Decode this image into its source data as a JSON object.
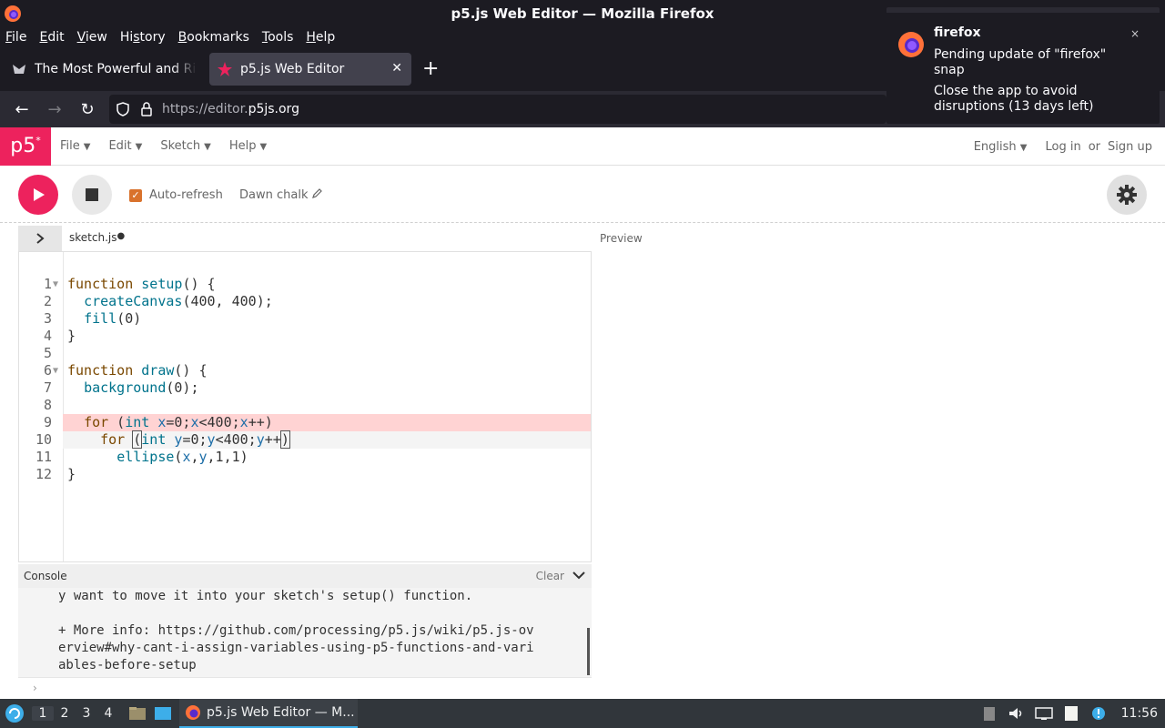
{
  "window": {
    "title": "p5.js Web Editor — Mozilla Firefox"
  },
  "menubar": {
    "items": [
      {
        "first": "F",
        "rest": "ile"
      },
      {
        "first": "E",
        "rest": "dit"
      },
      {
        "first": "V",
        "rest": "iew"
      },
      {
        "first": "",
        "under_mid": "s",
        "pre": "Hi",
        "rest": "tory",
        "full": "History"
      },
      {
        "first": "B",
        "rest": "ookmarks"
      },
      {
        "first": "T",
        "rest": "ools"
      },
      {
        "first": "H",
        "rest": "elp"
      }
    ]
  },
  "tabs": [
    {
      "title": "The Most Powerful and Rich",
      "active": false
    },
    {
      "title": "p5.js Web Editor",
      "active": true
    }
  ],
  "urlbar": {
    "prefix": "https://editor.",
    "host": "p5js.org"
  },
  "notification": {
    "title": "firefox",
    "body": "Pending update of \"firefox\" snap",
    "detail": "Close the app to avoid disruptions (13 days left)",
    "close": "×"
  },
  "p5nav": {
    "logo": "p5",
    "logo_sup": "*",
    "menus": [
      "File",
      "Edit",
      "Sketch",
      "Help"
    ],
    "language": "English",
    "login": "Log in",
    "or": "or",
    "signup": "Sign up"
  },
  "toolbar": {
    "autorefresh_label": "Auto-refresh",
    "autorefresh_checked": true,
    "sketch_name": "Dawn chalk"
  },
  "editor": {
    "file_name": "sketch.js",
    "unsaved_dot": "●",
    "preview_label": "Preview",
    "error_line": 9,
    "active_line": 10,
    "lines": [
      "function setup() {",
      "  createCanvas(400, 400);",
      "  fill(0)",
      "}",
      "",
      "function draw() {",
      "  background(0);",
      "",
      "  for (int x=0;x<400;x++)",
      "    for (int y=0;y<400;y++)",
      "      ellipse(x,y,1,1)",
      "}"
    ]
  },
  "console": {
    "title": "Console",
    "clear_label": "Clear",
    "lines": [
      "y want to move it into your sketch's setup() function.",
      "",
      "+ More info: https://github.com/processing/p5.js/wiki/p5.js-ov",
      "erview#why-cant-i-assign-variables-using-p5-functions-and-vari",
      "ables-before-setup"
    ],
    "prompt": "›"
  },
  "taskbar": {
    "workspaces": [
      "1",
      "2",
      "3",
      "4"
    ],
    "task_title": "p5.js Web Editor — M...",
    "clock": "11:56"
  },
  "colors": {
    "p5_pink": "#ed225d",
    "checkbox_orange": "#d9722c",
    "error_line_bg": "#ffd3d3",
    "firefox_dark": "#1c1b22"
  }
}
